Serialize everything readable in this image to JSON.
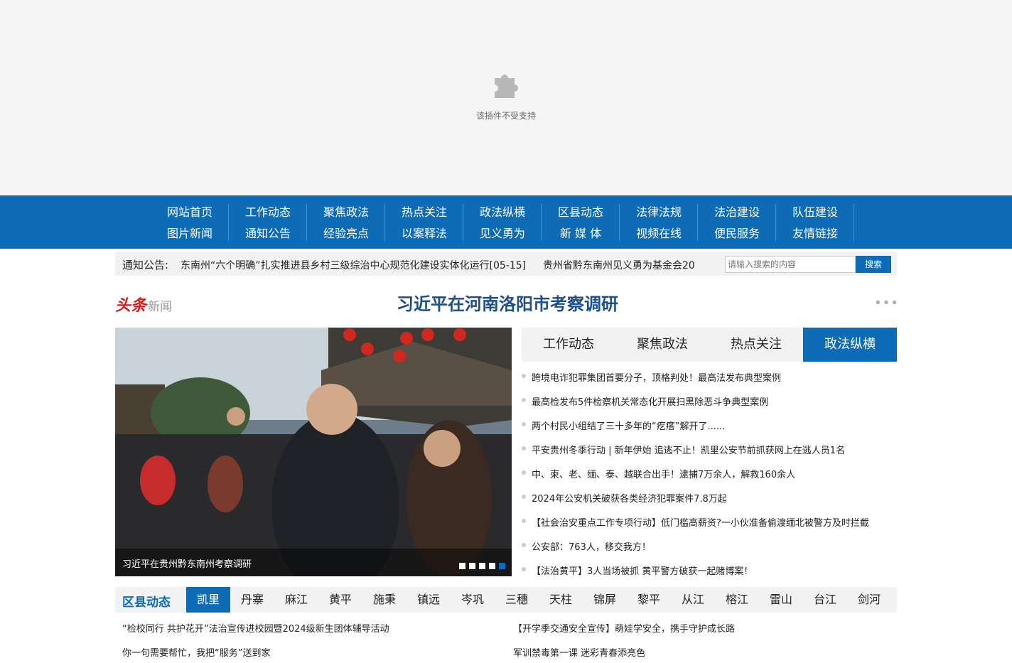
{
  "plugin": {
    "message": "该插件不受支持",
    "icon": "puzzle-icon"
  },
  "nav": {
    "row1": [
      "网站首页",
      "工作动态",
      "聚焦政法",
      "热点关注",
      "政法纵横",
      "区县动态",
      "法律法规",
      "法治建设",
      "队伍建设"
    ],
    "row2": [
      "图片新闻",
      "通知公告",
      "经验亮点",
      "以案释法",
      "见义勇为",
      "新 媒 体",
      "视频在线",
      "便民服务",
      "友情链接"
    ]
  },
  "notice": {
    "label": "通知公告:",
    "item1_text": "东南州“六个明确”扎实推进县乡村三级综治中心规范化建设实体化运行",
    "item1_date": "[05-15]",
    "item2_text": "贵州省黔东南州见义勇为基金会20"
  },
  "search": {
    "placeholder": "请输入搜索的内容",
    "button": "搜索"
  },
  "headline": {
    "logo_red": "头条",
    "logo_grey": "新闻",
    "title": "习近平在河南洛阳市考察调研",
    "more_icon": "more-dots-icon"
  },
  "slider": {
    "caption": "习近平在贵州黔东南州考察调研",
    "dot_count": 5,
    "active_dot": 4
  },
  "tabs": [
    "工作动态",
    "聚焦政法",
    "热点关注",
    "政法纵横"
  ],
  "active_tab": 3,
  "news": [
    "跨境电诈犯罪集团首要分子，顶格判处！最高法发布典型案例",
    "最高检发布5件检察机关常态化开展扫黑除恶斗争典型案例",
    "两个村民小组结了三十多年的“疙瘩”解开了......",
    "平安贵州冬季行动 | 新年伊始 追逃不止！凯里公安节前抓获网上在逃人员1名",
    "中、柬、老、缅、泰、越联合出手！逮捕7万余人，解救160余人",
    "2024年公安机关破获各类经济犯罪案件7.8万起",
    "【社会治安重点工作专项行动】低门槛高薪资?一小伙准备偷渡缅北被警方及时拦截",
    "公安部：763人，移交我方！",
    "【法治黄平】3人当场被抓 黄平警方破获一起赌博案！"
  ],
  "county": {
    "title": "区县动态",
    "tabs": [
      "凯里",
      "丹寨",
      "麻江",
      "黄平",
      "施秉",
      "镇远",
      "岑巩",
      "三穗",
      "天柱",
      "锦屏",
      "黎平",
      "从江",
      "榕江",
      "雷山",
      "台江",
      "剑河"
    ],
    "active": 0,
    "news_left": [
      "“检校同行 共护花开”法治宣传进校园暨2024级新生团体辅导活动",
      "你一句需要帮忙，我把“服务”送到家"
    ],
    "news_right": [
      "【开学季交通安全宣传】萌娃学安全，携手守护成长路",
      "军训禁毒第一课 迷彩青春添亮色"
    ]
  },
  "colors": {
    "brand_blue": "#0e6bb5",
    "headline_blue": "#1d4f8a",
    "logo_red": "#d41c1c"
  }
}
